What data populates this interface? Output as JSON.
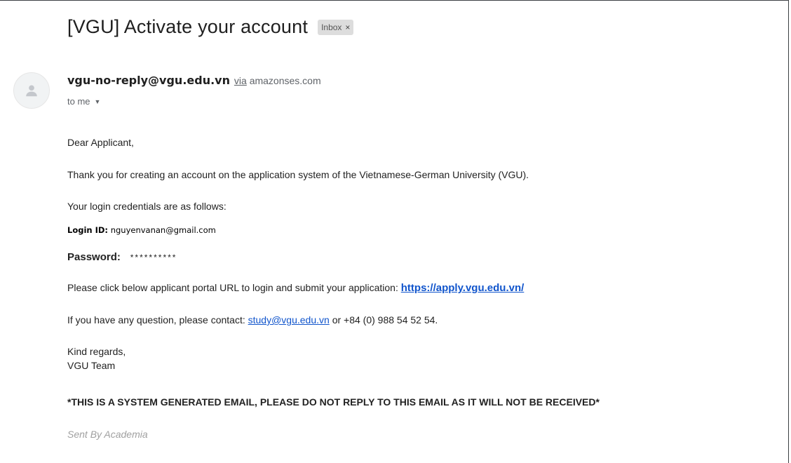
{
  "email": {
    "subject": "[VGU] Activate your account",
    "label": "Inbox",
    "label_close": "×",
    "sender_email": "vgu-no-reply@vgu.edu.vn",
    "via_text": "via",
    "via_domain": "amazonses.com",
    "to_text": "to me",
    "body": {
      "greeting": "Dear Applicant,",
      "thank_you": "Thank you for creating an account on the application system of the Vietnamese-German University (VGU).",
      "credentials_intro": "Your login credentials are as follows:",
      "login_id_label": "Login ID:",
      "login_id_value": "nguyenvanan@gmail.com",
      "password_label": "Password:",
      "password_value": "**********",
      "portal_text": "Please click below applicant portal URL to login and submit your application:",
      "portal_url": "https://apply.vgu.edu.vn/",
      "contact_text": "If you have any question, please contact:",
      "contact_email": "study@vgu.edu.vn",
      "contact_or": "or +84 (0) 988 54 52 54.",
      "regards": "Kind regards,",
      "team": "VGU Team",
      "notice": "*THIS IS A SYSTEM GENERATED EMAIL, PLEASE DO NOT REPLY TO THIS EMAIL AS IT WILL NOT BE RECEIVED*",
      "sent_by": "Sent By Academia"
    }
  },
  "icons": {
    "avatar": "person-icon",
    "to_dropdown": "caret-down-icon"
  },
  "colors": {
    "link": "#1155cc",
    "badge_bg": "#dddddd",
    "muted": "#5f6368"
  }
}
